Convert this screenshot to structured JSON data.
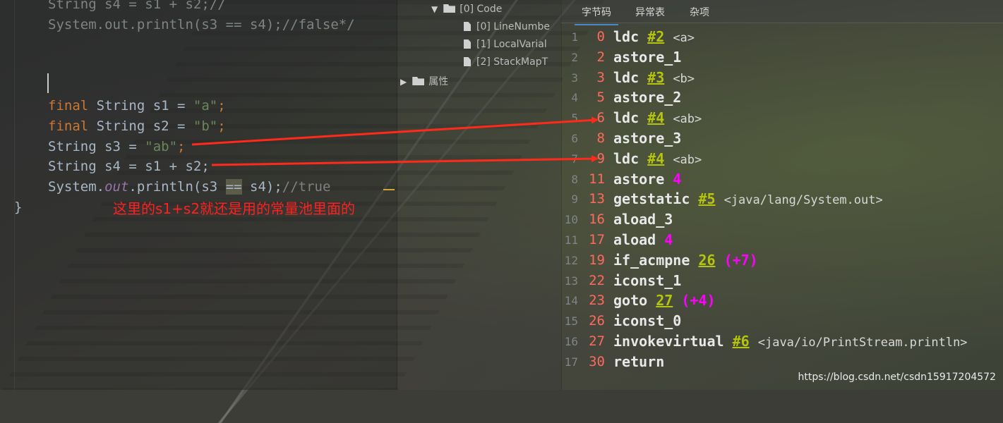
{
  "editor": {
    "lines_top": [
      "String s4 = s1 + s2;//",
      "System.out.println(s3 == s4);//false*/"
    ],
    "l1_kw": "final",
    "l1_rest": " String s1 = ",
    "l1_str": "\"a\"",
    "l1_end": ";",
    "l2_kw": "final",
    "l2_rest": " String s2 = ",
    "l2_str": "\"b\"",
    "l2_end": ";",
    "l3_rest": "String s3 = ",
    "l3_str": "\"ab\"",
    "l3_end": ";",
    "l4": "String s4 = s1 + s2;",
    "l5_a": "System.",
    "l5_out": "out",
    "l5_b": ".println(s3 ",
    "l5_eq": "==",
    "l5_c": " s4);",
    "l5_cmt": "//true",
    "brace": "}",
    "annotation": "这里的s1+s2就还是用的常量池里面的"
  },
  "tree": {
    "code": "[0] Code",
    "lnt": "[0] LineNumbe",
    "lvt": "[1] LocalVarial",
    "smt": "[2] StackMapT",
    "attrs": "属性"
  },
  "tabs": [
    "字节码",
    "异常表",
    "杂项"
  ],
  "bytecode": [
    {
      "ln": "1",
      "off": "0",
      "op": "ldc",
      "ref": "#2",
      "cmt": "<a>"
    },
    {
      "ln": "2",
      "off": "2",
      "op": "astore_1"
    },
    {
      "ln": "3",
      "off": "3",
      "op": "ldc",
      "ref": "#3",
      "cmt": "<b>"
    },
    {
      "ln": "4",
      "off": "5",
      "op": "astore_2"
    },
    {
      "ln": "5",
      "off": "6",
      "op": "ldc",
      "ref": "#4",
      "cmt": "<ab>"
    },
    {
      "ln": "6",
      "off": "8",
      "op": "astore_3"
    },
    {
      "ln": "7",
      "off": "9",
      "op": "ldc",
      "ref": "#4",
      "cmt": "<ab>"
    },
    {
      "ln": "8",
      "off": "11",
      "op": "astore",
      "mag": "4"
    },
    {
      "ln": "9",
      "off": "13",
      "op": "getstatic",
      "ref": "#5",
      "cmt": "<java/lang/System.out>"
    },
    {
      "ln": "10",
      "off": "16",
      "op": "aload_3"
    },
    {
      "ln": "11",
      "off": "17",
      "op": "aload",
      "mag": "4"
    },
    {
      "ln": "12",
      "off": "19",
      "op": "if_acmpne",
      "ref": "26",
      "mag": "(+7)"
    },
    {
      "ln": "13",
      "off": "22",
      "op": "iconst_1"
    },
    {
      "ln": "14",
      "off": "23",
      "op": "goto",
      "ref": "27",
      "mag": "(+4)"
    },
    {
      "ln": "15",
      "off": "26",
      "op": "iconst_0"
    },
    {
      "ln": "16",
      "off": "27",
      "op": "invokevirtual",
      "ref": "#6",
      "cmt": "<java/io/PrintStream.println>"
    },
    {
      "ln": "17",
      "off": "30",
      "op": "return"
    }
  ],
  "watermark": "https://blog.csdn.net/csdn15917204572",
  "colors": {
    "arrow": "#ff2a1a",
    "selection": "#2f65ca"
  }
}
